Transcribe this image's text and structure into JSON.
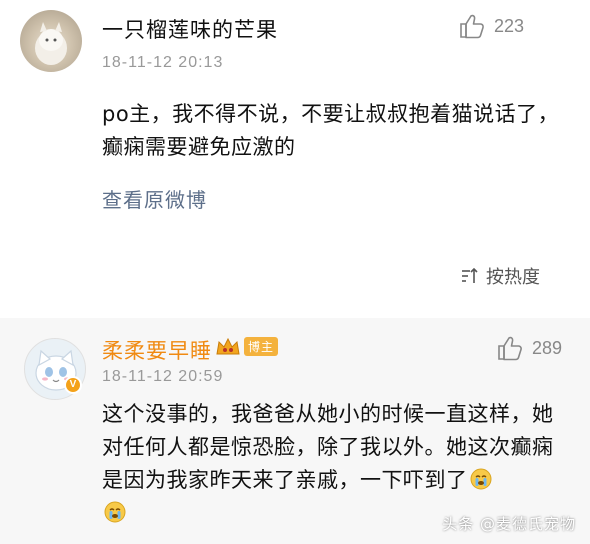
{
  "comments": [
    {
      "username": "一只榴莲味的芒果",
      "time": "18-11-12 20:13",
      "likes": "223",
      "text": "po主，我不得不说，不要让叔叔抱着猫说话了，癫痫需要避免应激的",
      "view_original": "查看原微博"
    },
    {
      "username": "柔柔要早睡",
      "time": "18-11-12 20:59",
      "likes": "289",
      "badge_level": "博主",
      "text": "这个没事的，我爸爸从她小的时候一直这样，她对任何人都是惊恐脸，除了我以外。她这次癫痫是因为我家昨天来了亲戚，一下吓到了"
    }
  ],
  "sort_label": "按热度",
  "watermark": "头条 @麦德氏宠物",
  "colors": {
    "username_highlight": "#f08a12",
    "link": "#5d6f8a",
    "meta": "#999999",
    "second_bg": "#f7f7f7"
  },
  "icons": {
    "like": "thumbs-up-icon",
    "sort": "sort-icon",
    "verified": "verified-v-icon",
    "crown": "crown-badge-icon",
    "emoji": "crying-emoji-icon"
  }
}
